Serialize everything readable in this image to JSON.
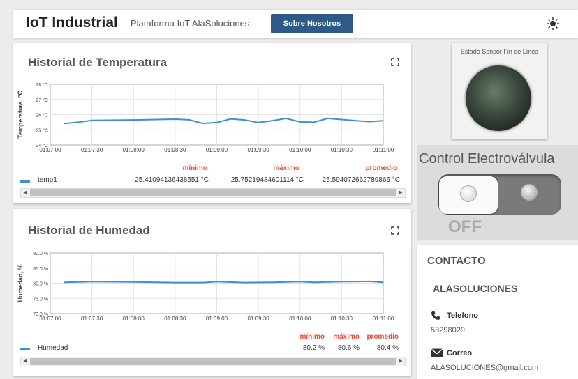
{
  "header": {
    "brand": "IoT Industrial",
    "tagline": "Plataforma IoT AlaSoluciones.",
    "about_button": "Sobre Nosotros",
    "theme_icon": "sun-icon"
  },
  "temperature": {
    "title": "Historial de Temperatura",
    "ylabel": "Temperatura, °C",
    "yticks": [
      "28 °C",
      "27 °C",
      "26 °C",
      "25 °C",
      "24 °C"
    ],
    "xticks": [
      "01:07:00",
      "01:07:30",
      "01:08:00",
      "01:08:30",
      "01:09:00",
      "01:09:30",
      "01:10:00",
      "01:10:30",
      "01:11:00"
    ],
    "stats_headers": [
      "mínimo",
      "máximo",
      "promedio"
    ],
    "series_name": "temp1",
    "min": "25.41094136438551 °C",
    "max": "25.75219484601114 °C",
    "avg": "25.594072662789866 °C"
  },
  "humidity": {
    "title": "Historial de Humedad",
    "ylabel": "Humedad, %",
    "yticks": [
      "90.0 %",
      "85.0 %",
      "80.0 %",
      "75.0 %",
      "70.0 %"
    ],
    "xticks": [
      "01:07:00",
      "01:07:30",
      "01:08:00",
      "01:08:30",
      "01:09:00",
      "01:09:30",
      "01:10:00",
      "01:10:30",
      "01:11:00"
    ],
    "stats_headers": [
      "mínimo",
      "máximo",
      "promedio"
    ],
    "series_name": "Humedad",
    "min": "80.2 %",
    "max": "80.6 %",
    "avg": "80.4 %"
  },
  "chart_data": [
    {
      "type": "line",
      "title": "Historial de Temperatura",
      "ylabel": "Temperatura, °C",
      "ylim": [
        24,
        28
      ],
      "x": [
        "01:07:10",
        "01:07:20",
        "01:07:30",
        "01:08:00",
        "01:08:30",
        "01:08:40",
        "01:08:50",
        "01:09:00",
        "01:09:10",
        "01:09:20",
        "01:09:30",
        "01:09:40",
        "01:09:50",
        "01:10:00",
        "01:10:10",
        "01:10:20",
        "01:10:30",
        "01:10:40",
        "01:10:50",
        "01:11:00"
      ],
      "series": [
        {
          "name": "temp1",
          "values": [
            25.41,
            25.5,
            25.62,
            25.65,
            25.7,
            25.66,
            25.42,
            25.48,
            25.72,
            25.65,
            25.48,
            25.6,
            25.75,
            25.52,
            25.5,
            25.75,
            25.68,
            25.6,
            25.54,
            25.6
          ]
        }
      ]
    },
    {
      "type": "line",
      "title": "Historial de Humedad",
      "ylabel": "Humedad, %",
      "ylim": [
        70,
        90
      ],
      "x": [
        "01:07:10",
        "01:07:30",
        "01:08:00",
        "01:08:30",
        "01:08:50",
        "01:09:00",
        "01:09:20",
        "01:09:40",
        "01:10:00",
        "01:10:10",
        "01:10:30",
        "01:10:50",
        "01:11:00"
      ],
      "series": [
        {
          "name": "Humedad",
          "values": [
            80.3,
            80.5,
            80.4,
            80.2,
            80.2,
            80.5,
            80.2,
            80.3,
            80.5,
            80.3,
            80.5,
            80.6,
            80.3
          ]
        }
      ]
    }
  ],
  "sensor": {
    "label": "Estado Sensor Fin de Línea",
    "state_color": "#3b473c"
  },
  "valve": {
    "title": "Control Electroválvula",
    "state": "OFF"
  },
  "contact": {
    "title": "CONTACTO",
    "company": "ALASOLUCIONES",
    "phone_label": "Telefono",
    "phone": "53298029",
    "email_label": "Correo",
    "email": "ALASOLUCIONES@gmail.com"
  },
  "colors": {
    "accent": "#2d5a87",
    "series": "#3d8fd6",
    "stat_header": "#e74c3c"
  }
}
